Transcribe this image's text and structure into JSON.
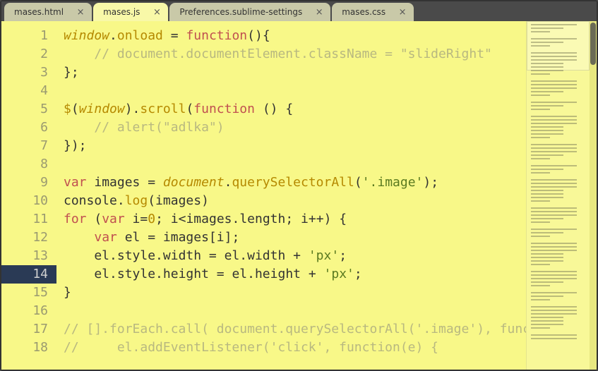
{
  "tabs": [
    {
      "label": "mases.html",
      "active": false
    },
    {
      "label": "mases.js",
      "active": true
    },
    {
      "label": "Preferences.sublime-settings",
      "active": false
    },
    {
      "label": "mases.css",
      "active": false
    }
  ],
  "editor": {
    "current_line": 14,
    "lines": [
      {
        "n": 1,
        "tokens": [
          [
            "glob",
            "window"
          ],
          [
            "plain",
            "."
          ],
          [
            "func",
            "onload"
          ],
          [
            "plain",
            " "
          ],
          [
            "op",
            "="
          ],
          [
            "plain",
            " "
          ],
          [
            "kw",
            "function"
          ],
          [
            "punct",
            "(){"
          ]
        ]
      },
      {
        "n": 2,
        "tokens": [
          [
            "plain",
            "    "
          ],
          [
            "cmt",
            "// document.documentElement.className = \"slideRight\""
          ]
        ]
      },
      {
        "n": 3,
        "tokens": [
          [
            "punct",
            "};"
          ]
        ]
      },
      {
        "n": 4,
        "tokens": [
          [
            "plain",
            ""
          ]
        ]
      },
      {
        "n": 5,
        "tokens": [
          [
            "dollar",
            "$"
          ],
          [
            "punct",
            "("
          ],
          [
            "glob",
            "window"
          ],
          [
            "punct",
            ")."
          ],
          [
            "func",
            "scroll"
          ],
          [
            "punct",
            "("
          ],
          [
            "kw",
            "function"
          ],
          [
            "plain",
            " "
          ],
          [
            "punct",
            "() {"
          ]
        ]
      },
      {
        "n": 6,
        "tokens": [
          [
            "plain",
            "    "
          ],
          [
            "cmt",
            "// alert(\"adlka\")"
          ]
        ]
      },
      {
        "n": 7,
        "tokens": [
          [
            "punct",
            "});"
          ]
        ]
      },
      {
        "n": 8,
        "tokens": [
          [
            "plain",
            ""
          ]
        ]
      },
      {
        "n": 9,
        "tokens": [
          [
            "kw",
            "var"
          ],
          [
            "plain",
            " images "
          ],
          [
            "op",
            "="
          ],
          [
            "plain",
            " "
          ],
          [
            "glob",
            "document"
          ],
          [
            "plain",
            "."
          ],
          [
            "func",
            "querySelectorAll"
          ],
          [
            "punct",
            "("
          ],
          [
            "str",
            "'.image'"
          ],
          [
            "punct",
            ");"
          ]
        ]
      },
      {
        "n": 10,
        "tokens": [
          [
            "plain",
            "console."
          ],
          [
            "func",
            "log"
          ],
          [
            "punct",
            "(images)"
          ]
        ]
      },
      {
        "n": 11,
        "tokens": [
          [
            "kw",
            "for"
          ],
          [
            "plain",
            " "
          ],
          [
            "punct",
            "("
          ],
          [
            "kw",
            "var"
          ],
          [
            "plain",
            " i"
          ],
          [
            "op",
            "="
          ],
          [
            "num",
            "0"
          ],
          [
            "punct",
            "; "
          ],
          [
            "plain",
            "i"
          ],
          [
            "op",
            "<"
          ],
          [
            "plain",
            "images."
          ],
          [
            "var",
            "length"
          ],
          [
            "punct",
            "; "
          ],
          [
            "plain",
            "i"
          ],
          [
            "op",
            "++"
          ],
          [
            "punct",
            ") {"
          ]
        ]
      },
      {
        "n": 12,
        "tokens": [
          [
            "plain",
            "    "
          ],
          [
            "kw",
            "var"
          ],
          [
            "plain",
            " el "
          ],
          [
            "op",
            "="
          ],
          [
            "plain",
            " images[i];"
          ]
        ]
      },
      {
        "n": 13,
        "tokens": [
          [
            "plain",
            "    el."
          ],
          [
            "var",
            "style"
          ],
          [
            "plain",
            "."
          ],
          [
            "var",
            "width"
          ],
          [
            "plain",
            " "
          ],
          [
            "op",
            "="
          ],
          [
            "plain",
            " el."
          ],
          [
            "var",
            "width"
          ],
          [
            "plain",
            " "
          ],
          [
            "op",
            "+"
          ],
          [
            "plain",
            " "
          ],
          [
            "str",
            "'px'"
          ],
          [
            "punct",
            ";"
          ]
        ]
      },
      {
        "n": 14,
        "tokens": [
          [
            "plain",
            "    el."
          ],
          [
            "var",
            "style"
          ],
          [
            "plain",
            "."
          ],
          [
            "var",
            "height"
          ],
          [
            "plain",
            " "
          ],
          [
            "op",
            "="
          ],
          [
            "plain",
            " el."
          ],
          [
            "var",
            "height"
          ],
          [
            "plain",
            " "
          ],
          [
            "op",
            "+"
          ],
          [
            "plain",
            " "
          ],
          [
            "str",
            "'px'"
          ],
          [
            "punct",
            ";"
          ]
        ]
      },
      {
        "n": 15,
        "tokens": [
          [
            "punct",
            "}"
          ]
        ]
      },
      {
        "n": 16,
        "tokens": [
          [
            "plain",
            ""
          ]
        ]
      },
      {
        "n": 17,
        "tokens": [
          [
            "cmt",
            "// [].forEach.call( document.querySelectorAll('.image'), function(el) {"
          ]
        ]
      },
      {
        "n": 18,
        "tokens": [
          [
            "cmt",
            "//     el.addEventListener('click', function(e) {"
          ]
        ]
      }
    ]
  }
}
